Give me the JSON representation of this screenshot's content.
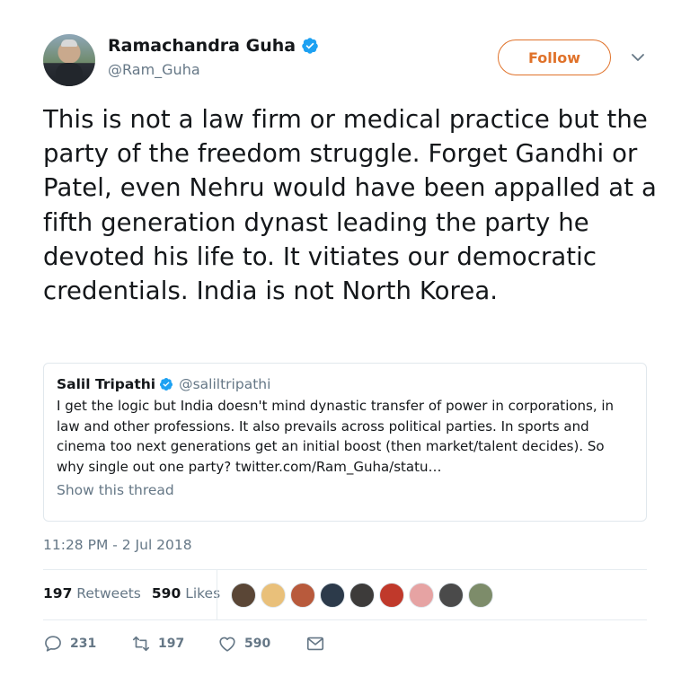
{
  "author": {
    "name": "Ramachandra Guha",
    "handle": "@Ram_Guha",
    "verified_icon": "verified-badge-icon",
    "follow_label": "Follow",
    "accent_color": "#e0722a"
  },
  "tweet": {
    "text": "This is not a law firm or medical practice but the party of the freedom struggle. Forget Gandhi or Patel, even Nehru would have been appalled at a fifth generation dynast leading the party he devoted his life to. It vitiates our democratic credentials. India is not North Korea."
  },
  "quote": {
    "name": "Salil Tripathi",
    "handle": "@saliltripathi",
    "text": "I get the logic but India doesn't mind dynastic transfer of power in corporations, in law and other professions. It also prevails across political parties. In sports and cinema too next generations get an initial boost (then market/talent decides). So why single out one party? twitter.com/Ram_Guha/statu…",
    "thread_link": "Show this thread"
  },
  "timestamp": "11:28 PM - 2 Jul 2018",
  "stats": {
    "retweets_count": "197",
    "retweets_label": "Retweets",
    "likes_count": "590",
    "likes_label": "Likes"
  },
  "likers": [
    {
      "color": "#5a4636"
    },
    {
      "color": "#e9c07a"
    },
    {
      "color": "#b85a3c"
    },
    {
      "color": "#2c3a4a"
    },
    {
      "color": "#3d3b3a"
    },
    {
      "color": "#c0392b"
    },
    {
      "color": "#e6a3a3"
    },
    {
      "color": "#4a4a4a"
    },
    {
      "color": "#7d8c6a"
    }
  ],
  "actions": {
    "reply_count": "231",
    "retweet_count": "197",
    "like_count": "590"
  }
}
